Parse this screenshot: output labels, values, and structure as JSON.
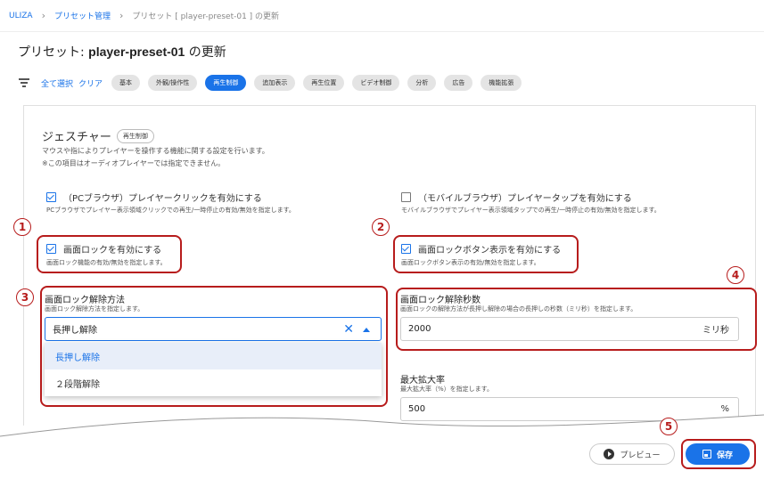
{
  "breadcrumb": {
    "root": "ULIZA",
    "level1": "プリセット管理",
    "current": "プリセット [ player-preset-01 ] の更新"
  },
  "page": {
    "title_prefix": "プリセット: ",
    "title_name": "player-preset-01",
    "title_suffix": " の更新"
  },
  "filter": {
    "select_all": "全て選択",
    "clear": "クリア",
    "chips": [
      "基本",
      "外観/操作性",
      "再生制御",
      "追加表示",
      "再生位置",
      "ビデオ制御",
      "分析",
      "広告",
      "機能拡張"
    ],
    "active_chip": "再生制御"
  },
  "section": {
    "title": "ジェスチャー",
    "badge": "再生制御",
    "desc1": "マウスや指によりプレイヤーを操作する機能に関する設定を行います。",
    "desc2": "※この項目はオーディオプレイヤーでは指定できません。"
  },
  "pc_click": {
    "label": "（PCブラウザ）プレイヤークリックを有効にする",
    "desc": "PCブラウザでプレイヤー表示領域クリックでの再生/一時停止の有効/無効を指定します。",
    "checked": true
  },
  "mobile_tap": {
    "label": "（モバイルブラウザ）プレイヤータップを有効にする",
    "desc": "モバイルブラウザでプレイヤー表示領域タップでの再生/一時停止の有効/無効を指定します。",
    "checked": false
  },
  "screen_lock": {
    "label": "画面ロックを有効にする",
    "desc": "画面ロック機能の有効/無効を指定します。",
    "checked": true
  },
  "lock_button": {
    "label": "画面ロックボタン表示を有効にする",
    "desc": "画面ロックボタン表示の有効/無効を指定します。",
    "checked": true
  },
  "unlock_method": {
    "label": "画面ロック解除方法",
    "desc": "画面ロック解除方法を指定します。",
    "value": "長押し解除",
    "options": [
      "長押し解除",
      "２段階解除"
    ]
  },
  "unlock_seconds": {
    "label": "画面ロック解除秒数",
    "desc": "画面ロックの解除方法が長押し解除の場合の長押しの秒数（ミリ秒）を指定します。",
    "value": "2000",
    "unit": "ミリ秒"
  },
  "max_zoom": {
    "label": "最大拡大率",
    "desc": "最大拡大率（%）を指定します。",
    "value": "500",
    "unit": "%"
  },
  "footer": {
    "preview": "プレビュー",
    "save": "保存"
  },
  "annotations": [
    "1",
    "2",
    "3",
    "4",
    "5"
  ],
  "colors": {
    "accent": "#1a73e8",
    "annotation": "#b71c1c"
  }
}
